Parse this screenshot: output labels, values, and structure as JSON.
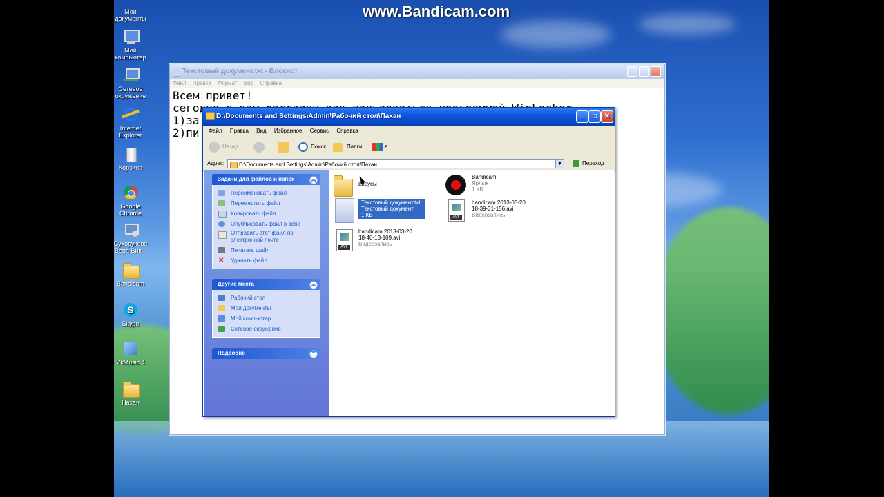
{
  "watermark": "www.Bandicam.com",
  "desktop_icons": [
    {
      "name": "desktop-icon-my-documents",
      "l1": "Мои",
      "l2": "документы",
      "icon": "documents-icon"
    },
    {
      "name": "desktop-icon-my-computer",
      "l1": "Мой",
      "l2": "компьютер",
      "icon": "computer-icon"
    },
    {
      "name": "desktop-icon-network",
      "l1": "Сетевое",
      "l2": "окружение",
      "icon": "network-icon"
    },
    {
      "name": "desktop-icon-ie",
      "l1": "Internet",
      "l2": "Explorer",
      "icon": "ie-icon"
    },
    {
      "name": "desktop-icon-recycle",
      "l1": "Корзина",
      "l2": "",
      "icon": "recycle-bin-icon"
    },
    {
      "name": "desktop-icon-chrome",
      "l1": "Google",
      "l2": "Chrome",
      "icon": "chrome-icon"
    },
    {
      "name": "desktop-icon-user",
      "l1": "Сухорукова",
      "l2": "Вера Вик...",
      "icon": "user-icon"
    },
    {
      "name": "desktop-icon-bandicam",
      "l1": "Bandicam",
      "l2": "",
      "icon": "folder-icon"
    },
    {
      "name": "desktop-icon-skype",
      "l1": "Skype",
      "l2": "",
      "icon": "skype-icon"
    },
    {
      "name": "desktop-icon-vkmusic",
      "l1": "VkMusic 4",
      "l2": "",
      "icon": "vkmusic-icon"
    },
    {
      "name": "desktop-icon-pakhan",
      "l1": "Пахан",
      "l2": "",
      "icon": "folder-icon"
    }
  ],
  "notepad": {
    "title": "Текстовый документ.txt - Блокнот",
    "menu": [
      "Файл",
      "Правка",
      "Формат",
      "Вид",
      "Справка"
    ],
    "lines": [
      "Всем привет!",
      "сегодня я вам расскажу как пользоваться программой WinLocker",
      "1)за",
      "2)пи"
    ]
  },
  "explorer": {
    "title": "D:\\Documents and Settings\\Admin\\Рабочий стол\\Пахан",
    "menu": [
      "Файл",
      "Правка",
      "Вид",
      "Избранное",
      "Сервис",
      "Справка"
    ],
    "toolbar": {
      "back": "Назад",
      "search": "Поиск",
      "folders": "Папки"
    },
    "address_label": "Адрес:",
    "address_value": "D:\\Documents and Settings\\Admin\\Рабочий стол\\Пахан",
    "go_label": "Переход",
    "tasks": {
      "header": "Задачи для файлов и папок",
      "items": [
        "Переименовать файл",
        "Переместить файл",
        "Копировать файл",
        "Опубликовать файл в вебе",
        "Отправить этот файл по",
        "электронной почте",
        "Печатать файл",
        "Удалить файл"
      ]
    },
    "places": {
      "header": "Другие места",
      "items": [
        "Рабочий стол",
        "Мои документы",
        "Мой компьютер",
        "Сетевое окружение"
      ]
    },
    "details": {
      "header": "Подробно"
    },
    "files": [
      {
        "name": "вирусы",
        "l2": "",
        "l3": ""
      },
      {
        "name": "Bandicam",
        "l2": "Ярлык",
        "l3": "1 КБ"
      },
      {
        "name": "Текстовый документ.txt",
        "l2": "Текстовый документ",
        "l3": "1 КБ"
      },
      {
        "name": "bandicam 2013-03-20",
        "l2": "18-39-31-156.avi",
        "l3": "Видеозапись"
      },
      {
        "name": "bandicam 2013-03-20",
        "l2": "18-40-13-109.avi",
        "l3": "Видеозапись"
      }
    ]
  }
}
